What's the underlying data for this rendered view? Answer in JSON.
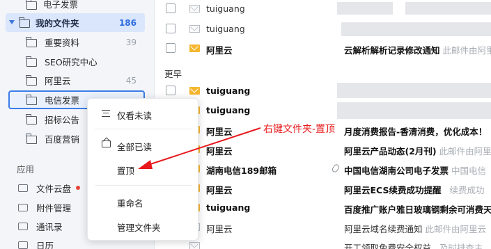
{
  "sidebar": {
    "top_item": {
      "label": "电子发票"
    },
    "my_folders": {
      "label": "我的文件夹",
      "count": "186"
    },
    "folders": [
      {
        "label": "重要资料",
        "count": "39"
      },
      {
        "label": "SEO研究中心",
        "count": ""
      },
      {
        "label": "阿里云",
        "count": "45"
      },
      {
        "label": "电信发票",
        "count": ""
      },
      {
        "label": "招标公告",
        "count": ""
      },
      {
        "label": "百度营销",
        "count": ""
      }
    ],
    "apps_title": "应用",
    "apps": [
      {
        "label": "文件云盘",
        "icon": "cloud-drive-icon",
        "badge": true
      },
      {
        "label": "附件管理",
        "icon": "attachment-manage-icon"
      },
      {
        "label": "通讯录",
        "icon": "contacts-icon"
      },
      {
        "label": "日历",
        "icon": "calendar-icon"
      }
    ]
  },
  "mail": {
    "group_earlier": "更早",
    "rows": [
      {
        "sender": "tuiguang",
        "read": true,
        "subject": "",
        "preview": ""
      },
      {
        "sender": "tuiguang",
        "read": true,
        "subject": "",
        "preview": ""
      },
      {
        "sender": "阿里云",
        "read": false,
        "subject": "云解析解析记录修改通知",
        "preview": "此邮件由阿里"
      },
      {
        "sender": "tuiguang",
        "read": false,
        "subject": "",
        "preview": ""
      },
      {
        "sender": "tuiguang",
        "read": false,
        "subject": "",
        "preview": ""
      },
      {
        "sender": "阿里云",
        "read": false,
        "subject": "月度消费报告-香清消费，优化成本！",
        "preview": ""
      },
      {
        "sender": "阿里云",
        "read": false,
        "subject": "阿里云产品动态(2月刊)",
        "preview": "此邮件由阿里"
      },
      {
        "sender": "湖南电信189邮箱",
        "read": false,
        "subject": "中国电信湖南公司电子发票",
        "preview": "中国电信"
      },
      {
        "sender": "阿里云",
        "read": false,
        "subject": "阿里云ECS续费成功提醒",
        "preview": "续费成功"
      },
      {
        "sender": "tuiguang",
        "read": false,
        "subject": "百度推广账户雅日玻璃钢剩余可消费天",
        "preview": ""
      },
      {
        "sender": "阿里云",
        "read": true,
        "subject": "阿里云域名续费通知",
        "preview": "此邮件由阿里云"
      },
      {
        "sender": "",
        "read": true,
        "subject": "开工领取免费安全权益",
        "preview": "及时排查主"
      }
    ]
  },
  "context_menu": {
    "items": [
      {
        "label": "仅看未读",
        "icon": "filter-lines-icon"
      },
      {
        "label": "全部已读",
        "icon": "open-mail-icon"
      },
      {
        "label": "置顶",
        "icon": ""
      },
      {
        "label": "重命名",
        "icon": ""
      },
      {
        "label": "管理文件夹",
        "icon": ""
      }
    ]
  },
  "annotation": {
    "text": "右键文件夹-置顶",
    "color": "#e8191c"
  },
  "colors": {
    "accent": "#3b7de8",
    "unread_envelope": "#f5b62e",
    "sidebar_bg": "#f3f5f9"
  }
}
